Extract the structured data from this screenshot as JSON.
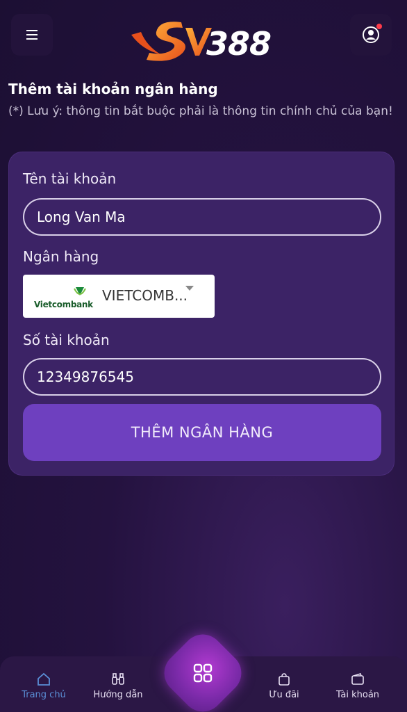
{
  "header": {
    "logo_text": "388",
    "menu_icon": "hamburger-icon",
    "user_icon": "user-circle-icon",
    "notification_color": "#ff3b4a"
  },
  "page": {
    "title": "Thêm tài khoản ngân hàng",
    "note": "(*) Lưu ý: thông tin bắt buộc phải là thông tin chính chủ của bạn!"
  },
  "form": {
    "account_name_label": "Tên tài khoản",
    "account_name_value": "Long Van Ma",
    "bank_label": "Ngân hàng",
    "bank_logo_text": "Vietcombank",
    "bank_selected": "VIETCOMB...",
    "account_number_label": "Số tài khoản",
    "account_number_value": "12349876545",
    "submit_label": "THÊM NGÂN HÀNG"
  },
  "bottom_nav": {
    "items": [
      {
        "label": "Trang chủ",
        "icon": "home-icon",
        "active": true
      },
      {
        "label": "Hướng dẫn",
        "icon": "binoculars-icon",
        "active": false
      },
      {
        "label": "Ưu đãi",
        "icon": "shopping-bag-icon",
        "active": false
      },
      {
        "label": "Tài khoản",
        "icon": "wallet-icon",
        "active": false
      }
    ],
    "center_icon": "grid-icon"
  },
  "colors": {
    "accent": "#6e40bf",
    "active_nav": "#5a8fd6",
    "card_bg": "#3c2366"
  }
}
